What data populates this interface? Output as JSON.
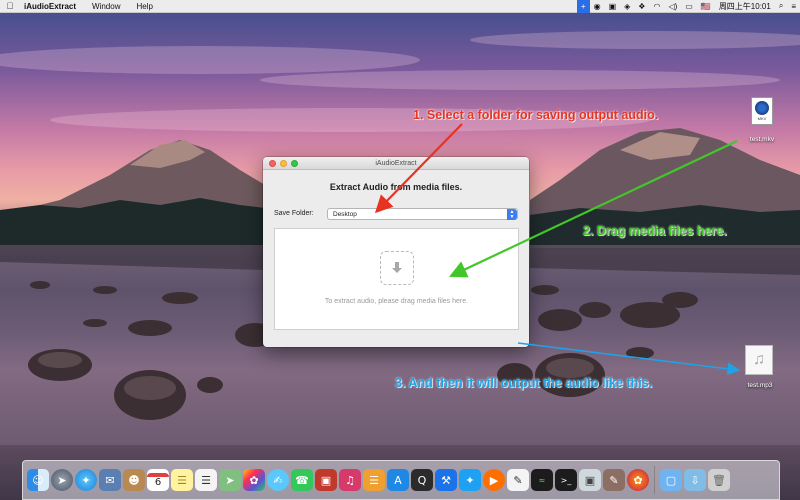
{
  "menubar": {
    "apple_glyph": "",
    "app_name": "iAudioExtract",
    "items": [
      "Window",
      "Help"
    ],
    "status": {
      "input_glyph": "+",
      "wifi_glyph": "◠",
      "volume_glyph": "◁)",
      "battery_glyph": "▭",
      "flag_glyph": "🇺🇸",
      "datetime": "周四上午10:01",
      "search_glyph": "⌕",
      "menu_glyph": "≡"
    }
  },
  "window": {
    "title": "iAudioExtract",
    "heading": "Extract Audio from media files.",
    "save_folder_label": "Save Folder:",
    "save_folder_value": "Desktop",
    "dropzone_text": "To extract audio, please drag media files here.",
    "dropzone_glyph": "⬇"
  },
  "desktop": {
    "file1": {
      "name": "test.mkv",
      "badge": "MKV"
    },
    "file2": {
      "name": "test.mp3",
      "glyph": "♫"
    }
  },
  "annotations": {
    "step1": "1. Select a folder for saving output audio.",
    "step2": "2. Drag media files here.",
    "step3": "3. And then it will output the audio like this."
  },
  "colors": {
    "step1": "#e63322",
    "step2": "#43c629",
    "step3": "#1fa2e6",
    "accent": "#3d7ff0"
  },
  "dock": {
    "calendar_day": "6"
  }
}
